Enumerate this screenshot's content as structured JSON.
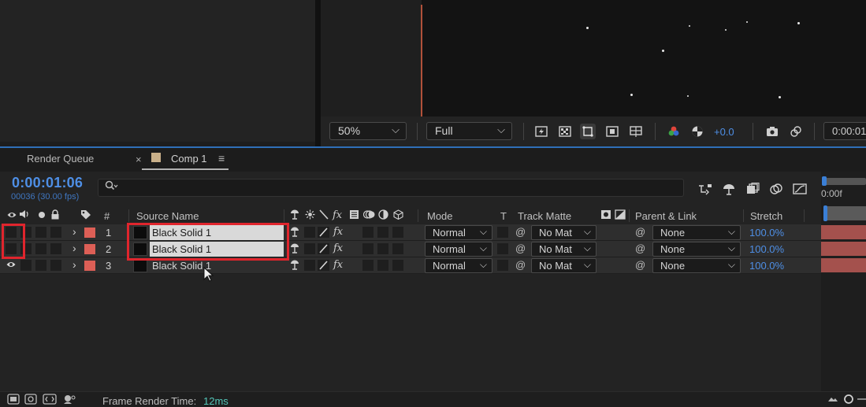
{
  "viewer": {
    "zoom": "50%",
    "resolution": "Full",
    "exposure": "+0.0",
    "timecode": "0:00:01"
  },
  "tabs": [
    {
      "label": "Render Queue"
    },
    {
      "label": "Comp 1",
      "close": "×",
      "menu": "≡"
    }
  ],
  "timeline": {
    "current_time": "0:00:01:06",
    "frame_info": "00036 (30.00 fps)",
    "ruler_label": "0:00f"
  },
  "columns": {
    "number": "#",
    "source_name": "Source Name",
    "mode": "Mode",
    "t": "T",
    "track_matte": "Track Matte",
    "parent_link": "Parent & Link",
    "stretch": "Stretch"
  },
  "layers": [
    {
      "number": "1",
      "name": "Black Solid 1",
      "mode": "Normal",
      "matte": "No Mat",
      "parent": "None",
      "stretch": "100.0%",
      "visible": false,
      "selected_name": true
    },
    {
      "number": "2",
      "name": "Black Solid 1",
      "mode": "Normal",
      "matte": "No Mat",
      "parent": "None",
      "stretch": "100.0%",
      "visible": false,
      "selected_name": true
    },
    {
      "number": "3",
      "name": "Black Solid 1",
      "mode": "Normal",
      "matte": "No Mat",
      "parent": "None",
      "stretch": "100.0%",
      "visible": true,
      "selected_name": false
    }
  ],
  "footer": {
    "render_time_label": "Frame Render Time:",
    "render_time_value": "12ms"
  },
  "colors": {
    "accent_blue": "#4e8fe6",
    "label_red": "#dd5f56",
    "highlight_red": "#e0252d",
    "render_time": "#53c5b8"
  }
}
